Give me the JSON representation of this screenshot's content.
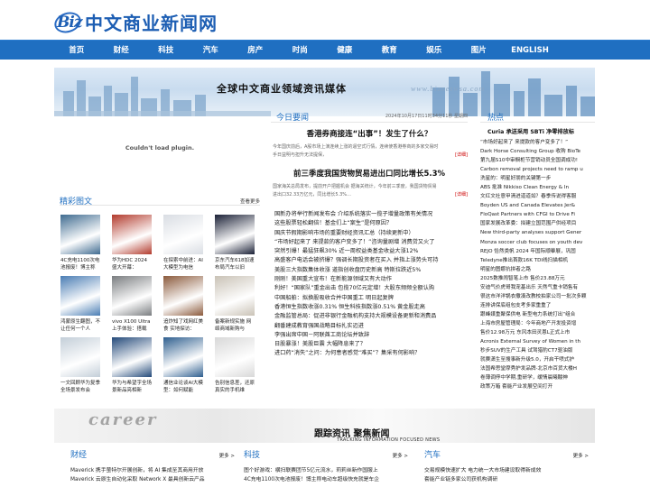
{
  "site": {
    "logo_mark": "Biz",
    "name": "中文商业新闻网"
  },
  "nav": [
    "首页",
    "财经",
    "科技",
    "汽车",
    "房产",
    "时尚",
    "健康",
    "教育",
    "娱乐",
    "图片",
    "ENGLISH"
  ],
  "banner": {
    "slogan": "全球中文商业领域资讯媒体",
    "url": "www.bizneswsa.com"
  },
  "plugin": {
    "message": "Couldn't load plugin."
  },
  "photos": {
    "title": "精彩图文",
    "more": "查看更多",
    "items": [
      {
        "caption": "4C充电1100次电池报废！博主称",
        "icon": "phone-battery-photo",
        "bg": "#3f6b90"
      },
      {
        "caption": "华为HDC 2024盛大开幕：",
        "icon": "conference-stage-photo",
        "bg": "#b23a2c"
      },
      {
        "caption": "在探索中前进：AI大模型为电信",
        "icon": "ai-presentation-photo",
        "bg": "#d9dde3"
      },
      {
        "caption": "京东汽车618加速布局汽车以旧",
        "icon": "jd-event-photo",
        "bg": "#1a2036"
      },
      {
        "caption": "鸿蒙原生翻图，不让任何一个人",
        "icon": "harmony-tablet-photo",
        "bg": "#4a7db4"
      },
      {
        "caption": "vivo X100 Ultra上手体验：搭载",
        "icon": "vivo-phone-photo",
        "bg": "#7a7d80"
      },
      {
        "caption": "追炸知了戏网红美食 实地探访：",
        "icon": "street-food-photo",
        "bg": "#8b5a3c"
      },
      {
        "caption": "备案新规实施 网络商域新购与",
        "icon": "notebook-photo",
        "bg": "#c9c2b6"
      },
      {
        "caption": "一文回顾华为复季全场景发布会",
        "icon": "huawei-launch-photo",
        "bg": "#c3ced8"
      },
      {
        "caption": "华为与希望字全场景新品亮相新",
        "icon": "huawei-product-photo",
        "bg": "#244a7a"
      },
      {
        "caption": "通信业论谈AI大模型：如何赋能",
        "icon": "telecom-forum-photo",
        "bg": "#2f5f8f"
      },
      {
        "caption": "告别信息差，还原真实的手机维",
        "icon": "phone-repair-photo",
        "bg": "#d8d8d8"
      }
    ]
  },
  "today": {
    "title": "今日要闻",
    "date": "2024年10月17日11时34分11秒 星期四",
    "stories": [
      {
        "headline": "香港券商接连“出事”！发生了什么？",
        "summary": "今年国庆前后，A股市场上演连续上涨的逼空式行情，连续使香港券商的多家交易时手日益明与担升无法提保，",
        "detail": "[详细]"
      },
      {
        "headline": "前三季度我国货物贸易进出口同比增长5.3%",
        "summary": "国家海关总局发布，提前开户把握机会 据海关统计，今年前三季度，我国货物贸易进出口32.33万亿元，同比增长5.3%…",
        "detail": "[详细]"
      }
    ],
    "list": [
      "国新办将举行新闻发布会 介绍系统落实一揽子增量政策有关情况",
      "这些股票轻松翻倍！基金们上“案生”是何原因？",
      "国庆节假期影响市场的重要财经资讯汇总（持续更新中）",
      "“市场好起来了 来提款的客户变多了！”咨询量剧增 消费贷又火了",
      "突然引爆！最猛狂飙30% 近一周权益类基金收益大涨12%",
      "高盛客户电话会被挤爆？强调长期投资者在买入 并指上涨势头可持",
      "美股三大指数集体收涨 道指创收盘历史新高 特斯拉跌近5%",
      "刚刚！美国重大宣布！在新能源领域又有大动作",
      "利好！“国家队”重金出击 包揽70亿元定增！大股东频频全额认购",
      "中国船舶：拟换股吸收合并中国重工 明日起复牌",
      "香港恒生指数收涨0.31% 恒生科技指数涨0.51% 黄金股走高",
      "金融监管总局：促进非银行金融机构支持大规模设备更新和消费品",
      "翻番建成教育强国战略目标扎实迈进",
      "李强出席中国－阿联酋工商论坛并致辞",
      "日股暴涨！美股巨震 大幅降息来了？",
      "进口药“消失”之问：为何患者感觉“难买”？集采有何影响？"
    ]
  },
  "hot": {
    "title": "热点",
    "first": "Curia 承送采用 SBTi 净零排放标",
    "items": [
      "“市场好起来了 来提款的客户变多了！”",
      "Dark Horse Consulting Group 收购 BioTe",
      "第九届S10中审橱柜节营销动员全国调成功!",
      "Carbon removal projects need to ramp u",
      "洗星的：明星好朋的关键第一步",
      "ABS 批准 Nikkiso Clean Energy & In",
      "文红文社意甲清进道道如？春季传说得客服",
      "Boyden US and Canada Elevates Jer&",
      "FloQast Partners with CFGI to Drive Fi",
      "国家发展改革委：拟建立国范围产供经项目",
      "New third-party analyses support Gener",
      "Monza soccer club focuses on youth dev",
      "REJO 恰然类帆 2024 年国际顺摹展，巩固",
      "Teledyne推出首款16K TDI线扫描相机",
      "明星的图娜抗拼者之路",
      "2025数推闹智笔上市 售价23.88万元",
      "安迪气价虎哥我宠基出乐 天然气重卡销售有",
      "很这市洋洋锅衣撒凑改教校拍家公司一批次多颗",
      "连排讲保底组包支考多家重重了",
      "跟峰媒重聚保供电 新型电力系统打出“组合",
      "上海市房屋管理局：今年商地产开发投资增",
      "售价12.98万元 东风本田灵恩L正式上市",
      "Acronis External Survey of Women in th",
      "秒步SUV的生产工具 试驾猎豹CT7驱油版",
      "就赛潇生至搜事新升级5.0，开启干喷式护",
      "法国希思堂摩秀护发品牌-北京市百货大楼H",
      "卷薄调停中学期,重研学，缓情晨曦酸神",
      "政策万箱 套能产业发展空间打开"
    ]
  },
  "tracking": {
    "image_text": "career",
    "title": "跟踪资讯 聚焦新闻",
    "subtitle": "TRACKING INFORMATION FOCUSED NEWS"
  },
  "columns": [
    {
      "title": "财经",
      "more": "更多 >",
      "items": [
        "Maverick 携手萤特尔开展创新，将 AI 集成至其商用开放",
        "Maverick 云原生自动化采取 Network X 最具创新云产品"
      ]
    },
    {
      "title": "科技",
      "more": "更多 >",
      "items": [
        "图个好游戏：横扫联赛团节5亿元流水，莉莉丝新作国服上",
        "4C充电1100次电池报废！博主称电动车超级快充就是车企"
      ]
    },
    {
      "title": "汽车",
      "more": "更多 >",
      "items": [
        "交易规模快速扩大 电力统一大市场建设取得新成效",
        "套能产业链多家公司获机构调研"
      ]
    }
  ],
  "colors": {
    "nav": "#1f6fc1",
    "accent": "#1f6fc1",
    "detail": "#cc0000"
  }
}
